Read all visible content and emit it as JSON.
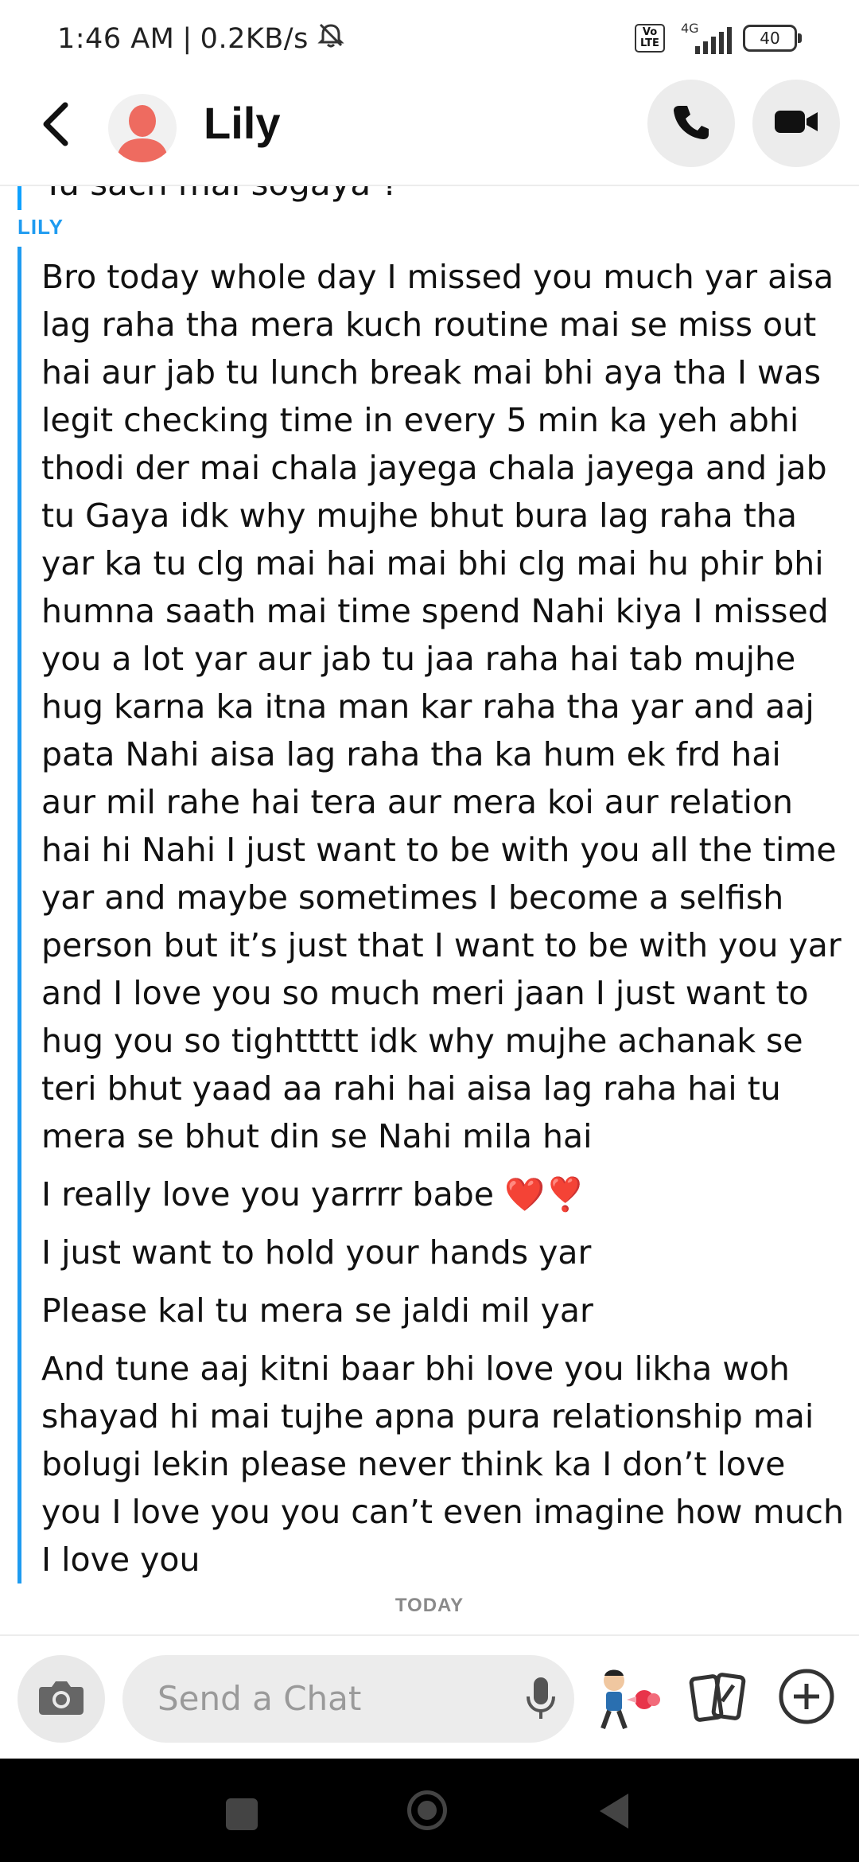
{
  "status_bar": {
    "time": "1:46 AM",
    "speed": "0.2KB/s",
    "network_badge": "Vo LTE",
    "network_type": "4G",
    "battery": "40"
  },
  "header": {
    "contact_name": "Lily",
    "icons": [
      "back-chevron",
      "avatar",
      "phone",
      "video-camera"
    ]
  },
  "chat": {
    "previous_message_partial": "Tu sach mai sogaya ?",
    "sender_label": "LILY",
    "messages": [
      "Bro today whole day I missed you much yar aisa lag raha tha mera kuch routine mai se miss out hai aur jab tu lunch break mai bhi aya tha I was legit checking time in every 5 min ka yeh abhi thodi der mai chala jayega chala jayega and jab tu Gaya idk why mujhe bhut bura lag raha tha yar ka tu clg mai hai mai bhi clg mai hu phir bhi humna saath mai time spend Nahi kiya I missed you a lot yar aur jab tu jaa raha hai tab mujhe hug karna ka itna man kar raha tha yar and aaj pata Nahi aisa lag raha tha ka hum ek frd hai aur mil rahe hai tera aur mera koi aur relation hai hi Nahi I just want to be with you all the time yar and maybe sometimes I become a selfish person but it’s just that I want to be with you yar and I love you so much meri jaan I just want to hug you so tighttttt idk why mujhe achanak se teri bhut yaad aa rahi hai aisa lag raha hai tu mera se bhut din se Nahi mila hai",
      "I really love you yarrrr babe ❤️❣️",
      "I just want to hold your hands yar",
      "Please kal tu mera se jaldi mil yar",
      "And tune aaj kitni baar bhi love you likha woh shayad hi mai tujhe apna pura relationship mai bolugi lekin please never think ka I don’t love you I love you you can’t even imagine how much I love you"
    ],
    "day_divider": "TODAY"
  },
  "composer": {
    "placeholder": "Send a Chat",
    "icons": [
      "camera",
      "microphone",
      "bitmoji",
      "cards",
      "plus"
    ]
  },
  "colors": {
    "accent_blue": "#1e9bf0",
    "bubble_gray": "#ececec",
    "nav_black": "#000000"
  }
}
